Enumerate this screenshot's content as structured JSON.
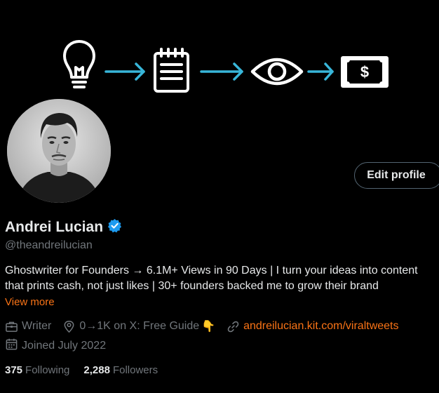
{
  "banner": {
    "icons": [
      "lightbulb-icon",
      "arrow-right-icon",
      "notepad-icon",
      "arrow-right-icon",
      "eye-icon",
      "arrow-right-icon",
      "dollar-bill-icon"
    ],
    "icon_color": "#ffffff",
    "arrow_color": "#38b6d9",
    "bill_symbol": "$"
  },
  "profile": {
    "avatar": "profile-photo",
    "edit_label": "Edit profile",
    "name": "Andrei Lucian",
    "verified_color": "#1d9bf0",
    "handle": "@theandreilucian",
    "bio_line1": "Ghostwriter for Founders → 6.1M+ Views in 90 Days | I turn your ideas into content",
    "bio_line2": "that prints cash, not just likes | 30+ founders backed me to grow their brand",
    "view_more": "View more",
    "profession": "Writer",
    "location": "0→1K on X: Free Guide",
    "location_emoji": "👇",
    "link": "andreilucian.kit.com/viraltweets",
    "joined": "Joined July 2022",
    "following_count": "375",
    "following_label": "Following",
    "followers_count": "2,288",
    "followers_label": "Followers"
  },
  "colors": {
    "background": "#000000",
    "text": "#e7e9ea",
    "muted": "#71767b",
    "accent": "#f97316"
  }
}
